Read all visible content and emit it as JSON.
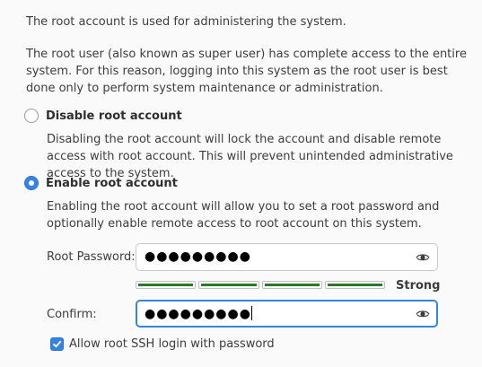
{
  "intro": {
    "line1": "The root account is used for administering the system.",
    "line2": "The root user (also known as super user) has complete access to the entire system. For this reason, logging into this system as the root user is best done only to perform system maintenance or administration."
  },
  "options": {
    "disable": {
      "label": "Disable root account",
      "description": "Disabling the root account will lock the account and disable remote access with root account. This will prevent unintended administrative access to the system.",
      "selected": false
    },
    "enable": {
      "label": "Enable root account",
      "description": "Enabling the root account will allow you to set a root password and optionally enable remote access to root account on this system.",
      "selected": true
    }
  },
  "password": {
    "label": "Root Password:",
    "value": "●●●●●●●●●",
    "icon": "eye-icon"
  },
  "strength": {
    "label": "Strong",
    "level": 1.0,
    "color": "#2a7a2a"
  },
  "confirm": {
    "label": "Confirm:",
    "value": "●●●●●●●●●",
    "icon": "eye-icon"
  },
  "ssh": {
    "label": "Allow root SSH login with password",
    "checked": true
  },
  "colors": {
    "accent": "#3584e4",
    "background": "#fafafa",
    "text": "#3d3d3d"
  }
}
